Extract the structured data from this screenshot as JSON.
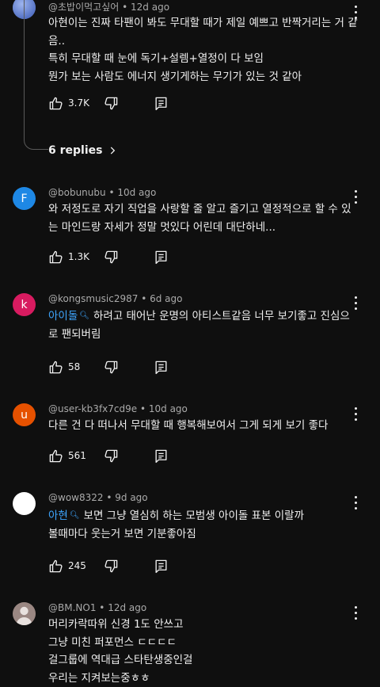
{
  "comments": [
    {
      "author": "@초밥이먹고싶어",
      "time": "12d ago",
      "lines": [
        "아현이는 진짜 타팬이 봐도 무대할 때가 제일 예쁘고 반짝거리는 거 같",
        "음..",
        "특히 무대할 때 눈에 독기+설렘+열정이 다 보임",
        "뭔가 보는 사람도 에너지 생기게하는 무기가 있는 것 같아"
      ],
      "likes": "3.7K",
      "avatar_color": "#6a8ad6"
    },
    {
      "author": "@bobunubu",
      "time": "10d ago",
      "avatar_letter": "F",
      "avatar_color": "#1e88e5",
      "lines": [
        "와 저정도로 자기 직업을 사랑할 줄 알고 즐기고 열정적으로 할 수 있",
        "는 마인드랑 자세가 정말 멋있다 어린데 대단하네..."
      ],
      "likes": "1.3K"
    },
    {
      "author": "@kongsmusic2987",
      "time": "6d ago",
      "avatar_letter": "k",
      "avatar_color": "#d81b60",
      "mention": "아이돌",
      "lines": [
        "하려고 태어난 운명의 아티스트같음 너무 보기좋고 진심으",
        "로 팬되버림"
      ],
      "likes": "58"
    },
    {
      "author": "@user-kb3fx7cd9e",
      "time": "10d ago",
      "avatar_letter": "u",
      "avatar_color": "#e65100",
      "lines": [
        "다른 건 다 떠나서 무대할 때 행복해보여서 그게 되게 보기 좋다"
      ],
      "likes": "561"
    },
    {
      "author": "@wow8322",
      "time": "9d ago",
      "avatar_color": "#ffffff",
      "mention": "아현",
      "lines": [
        "보면 그냥 열심히 하는 모범생 아이돌 표본 이랄까",
        "볼때마다 웃는거 보면 기분좋아짐"
      ],
      "likes": "245"
    },
    {
      "author": "@BM.NO1",
      "time": "12d ago",
      "avatar_color": "#8d7b76",
      "lines": [
        "머리카락따위 신경 1도 안쓰고",
        "그냥 미친 퍼포먼스 ㄷㄷㄷㄷ",
        "걸그룹에 역대급 스타탄생중인걸",
        "우리는 지켜보는중ㅎㅎ"
      ]
    }
  ],
  "replies_label": "6 replies",
  "separator": "•",
  "icons": {
    "like": "thumbs-up-icon",
    "dislike": "thumbs-down-icon",
    "reply": "reply-icon",
    "more": "more-vert-icon",
    "mention_search": "search-icon",
    "chevron": "chevron-right-icon"
  }
}
